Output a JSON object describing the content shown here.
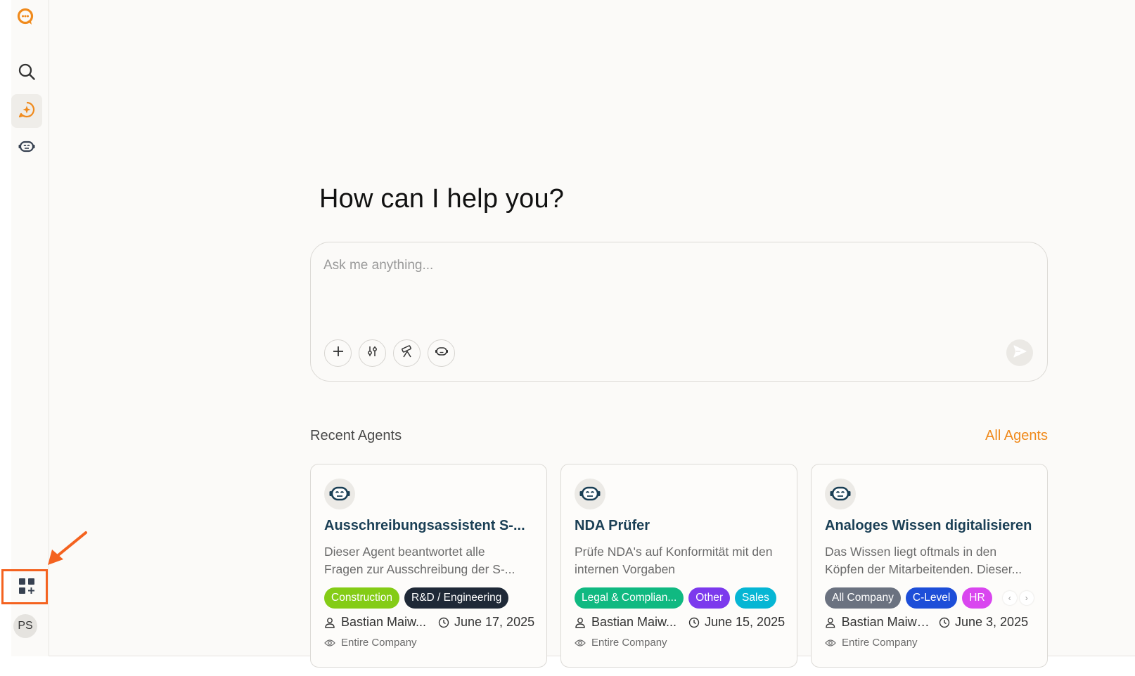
{
  "colors": {
    "accent": "#f08a1c",
    "highlight": "#f4621f",
    "title_text": "#1a3f55"
  },
  "sidebar": {
    "logo": "chat-logo-icon",
    "items": [
      {
        "icon": "search-icon",
        "active": false
      },
      {
        "icon": "new-chat-sparkle-icon",
        "active": true
      },
      {
        "icon": "robot-icon",
        "active": false
      }
    ],
    "bottom": {
      "icon": "add-app-grid-icon"
    },
    "avatar_initials": "PS"
  },
  "main": {
    "heading": "How can I help you?",
    "chat": {
      "placeholder": "Ask me anything...",
      "tools": [
        "plus-icon",
        "sliders-icon",
        "telescope-icon",
        "robot-icon"
      ],
      "send_icon": "send-icon"
    },
    "recent_agents": {
      "title": "Recent Agents",
      "all_link": "All Agents",
      "cards": [
        {
          "title": "Ausschreibungsassistent S-...",
          "desc_line1": "Dieser Agent beantwortet alle",
          "desc_line2": "Fragen zur Ausschreibung der S-...",
          "tags": [
            {
              "label": "Construction",
              "color": "#84cc16"
            },
            {
              "label": "R&D / Engineering",
              "color": "#1f2937"
            }
          ],
          "author": "Bastian Maiw...",
          "date": "June 17, 2025",
          "visibility": "Entire Company"
        },
        {
          "title": "NDA Prüfer",
          "desc_line1": "Prüfe NDA's auf Konformität mit den",
          "desc_line2": "internen Vorgaben",
          "tags": [
            {
              "label": "Legal & Complian...",
              "color": "#10b981"
            },
            {
              "label": "Other",
              "color": "#7c3aed"
            },
            {
              "label": "Sales",
              "color": "#06b6d4"
            }
          ],
          "author": "Bastian Maiw...",
          "date": "June 15, 2025",
          "visibility": "Entire Company"
        },
        {
          "title": "Analoges Wissen digitalisieren",
          "desc_line1": "Das Wissen liegt oftmals in den",
          "desc_line2": "Köpfen der Mitarbeitenden. Dieser...",
          "tags": [
            {
              "label": "All Company",
              "color": "#6b7280"
            },
            {
              "label": "C-Level",
              "color": "#1d4ed8"
            },
            {
              "label": "HR",
              "color": "#d946ef"
            }
          ],
          "author": "Bastian Maiwo...",
          "date": "June 3, 2025",
          "visibility": "Entire Company"
        }
      ]
    }
  }
}
